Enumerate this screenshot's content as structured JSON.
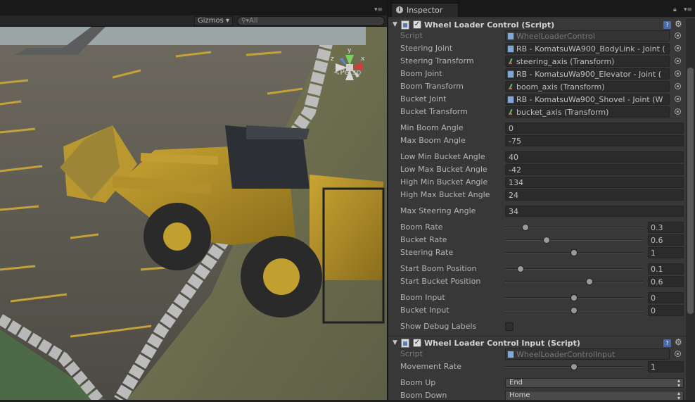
{
  "scene": {
    "gizmos_label": "Gizmos",
    "search_placeholder": "All",
    "persp_label": "Persp",
    "gizmo_axes": {
      "y": "y",
      "z": "z",
      "x": "x"
    }
  },
  "inspector": {
    "tab_label": "Inspector",
    "components": [
      {
        "title": "Wheel Loader Control (Script)",
        "script_label": "Script",
        "script_value": "WheelLoaderControl",
        "object_fields": [
          {
            "label": "Steering Joint",
            "value": "RB - KomatsuWA900_BodyLink - Joint (",
            "icon": "rigidbody-icon"
          },
          {
            "label": "Steering Transform",
            "value": "steering_axis (Transform)",
            "icon": "transform-icon"
          },
          {
            "label": "Boom Joint",
            "value": "RB - KomatsuWa900_Elevator - Joint (",
            "icon": "rigidbody-icon"
          },
          {
            "label": "Boom Transform",
            "value": "boom_axis (Transform)",
            "icon": "transform-icon"
          },
          {
            "label": "Bucket Joint",
            "value": "RB - KomatsuWa900_Shovel - Joint (W",
            "icon": "rigidbody-icon"
          },
          {
            "label": "Bucket Transform",
            "value": "bucket_axis (Transform)",
            "icon": "transform-icon"
          }
        ],
        "number_fields": [
          {
            "label": "Min Boom Angle",
            "value": "0"
          },
          {
            "label": "Max Boom Angle",
            "value": "-75"
          },
          {
            "label": "Low Min Bucket Angle",
            "value": "40"
          },
          {
            "label": "Low Max Bucket Angle",
            "value": "-42"
          },
          {
            "label": "High Min Bucket Angle",
            "value": "134"
          },
          {
            "label": "High Max Bucket Angle",
            "value": "24"
          },
          {
            "label": "Max Steering Angle",
            "value": "34"
          }
        ],
        "sliders": [
          {
            "label": "Boom Rate",
            "value": "0.3",
            "fraction": 0.15
          },
          {
            "label": "Bucket Rate",
            "value": "0.6",
            "fraction": 0.3
          },
          {
            "label": "Steering Rate",
            "value": "1",
            "fraction": 0.5
          },
          {
            "label": "Start Boom Position",
            "value": "0.1",
            "fraction": 0.11
          },
          {
            "label": "Start Bucket Position",
            "value": "0.6",
            "fraction": 0.61
          },
          {
            "label": "Boom Input",
            "value": "0",
            "fraction": 0.5
          },
          {
            "label": "Bucket Input",
            "value": "0",
            "fraction": 0.5
          }
        ],
        "toggle": {
          "label": "Show Debug Labels",
          "checked": false
        }
      },
      {
        "title": "Wheel Loader Control Input (Script)",
        "script_label": "Script",
        "script_value": "WheelLoaderControlInput",
        "sliders": [
          {
            "label": "Movement Rate",
            "value": "1",
            "fraction": 0.5
          }
        ],
        "popups": [
          {
            "label": "Boom Up",
            "value": "End"
          },
          {
            "label": "Boom Down",
            "value": "Home"
          }
        ]
      }
    ]
  }
}
